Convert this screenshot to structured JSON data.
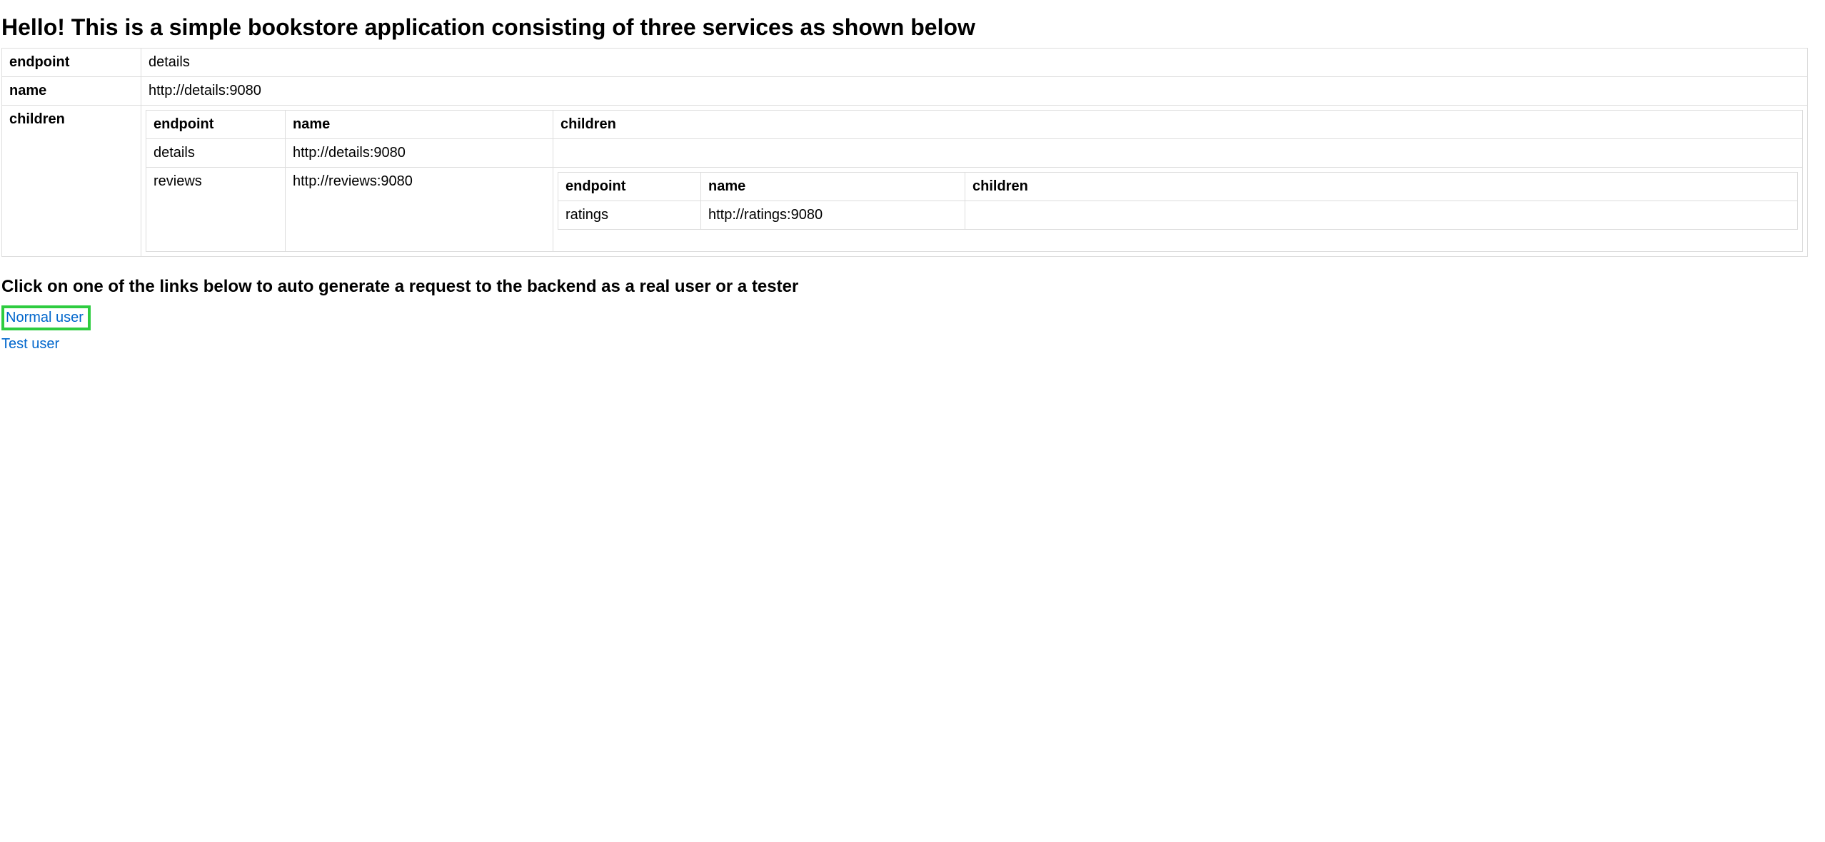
{
  "header": {
    "title": "Hello! This is a simple bookstore application consisting of three services as shown below"
  },
  "table": {
    "row1": {
      "key": "endpoint",
      "value": "details"
    },
    "row2": {
      "key": "name",
      "value": "http://details:9080"
    },
    "row3": {
      "key": "children",
      "headers": {
        "endpoint": "endpoint",
        "name": "name",
        "children": "children"
      },
      "rows": [
        {
          "endpoint": "details",
          "name": "http://details:9080",
          "children": ""
        },
        {
          "endpoint": "reviews",
          "name": "http://reviews:9080",
          "children": {
            "headers": {
              "endpoint": "endpoint",
              "name": "name",
              "children": "children"
            },
            "rows": [
              {
                "endpoint": "ratings",
                "name": "http://ratings:9080",
                "children": ""
              }
            ]
          }
        }
      ]
    }
  },
  "links": {
    "heading": "Click on one of the links below to auto generate a request to the backend as a real user or a tester",
    "normal": "Normal user",
    "test": "Test user"
  }
}
